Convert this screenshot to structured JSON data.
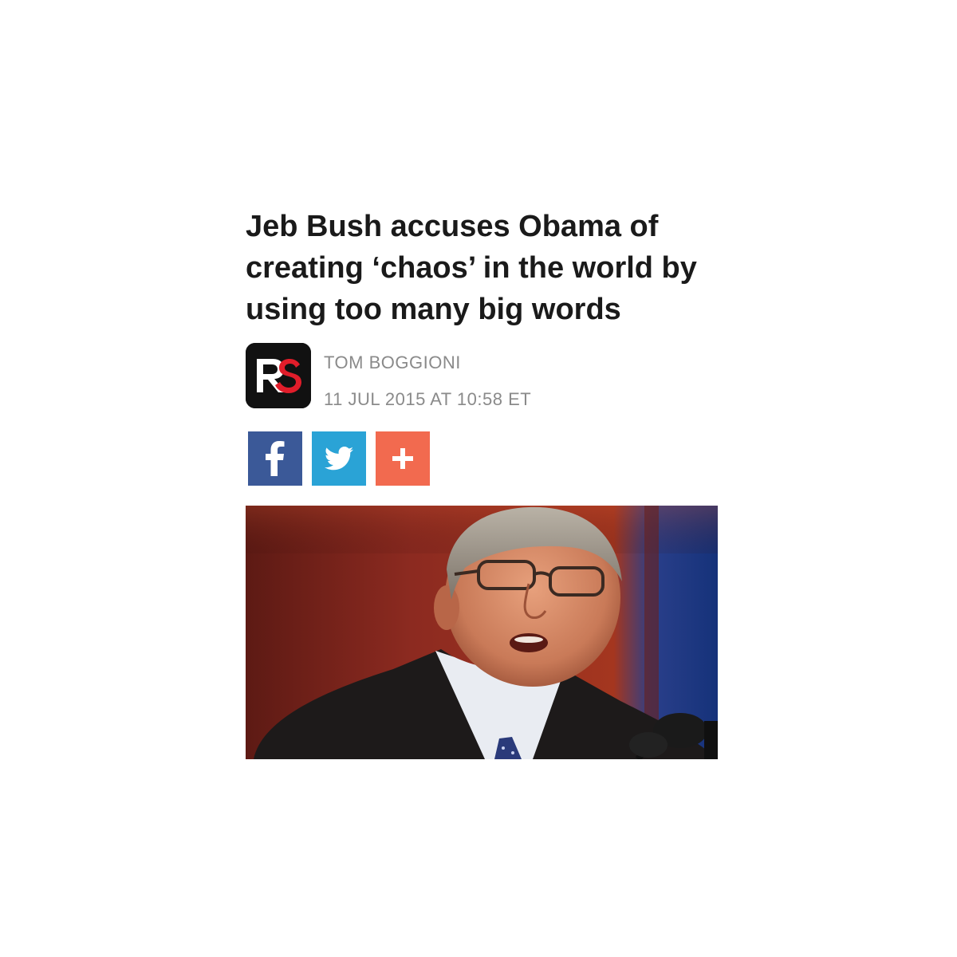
{
  "article": {
    "headline": "Jeb Bush accuses Obama of creating ‘chaos’ in the world by using too many big words",
    "author": "TOM BOGGIONI",
    "date": "11 JUL 2015 AT 10:58 ET",
    "publisher_logo": {
      "text": "RS",
      "colors": {
        "background": "#111111",
        "r": "#ffffff",
        "s": "#e11d2a"
      }
    }
  },
  "share": [
    {
      "name": "facebook",
      "icon": "facebook-icon",
      "color": "#3b5998"
    },
    {
      "name": "twitter",
      "icon": "twitter-icon",
      "color": "#2aa3d6"
    },
    {
      "name": "more",
      "icon": "plus-icon",
      "color": "#f26a4f"
    }
  ],
  "hero_image": {
    "subject": "man speaking at a podium with microphones",
    "colors": {
      "background_left": "#8a2a22",
      "background_right": "#1e3f8a"
    }
  }
}
